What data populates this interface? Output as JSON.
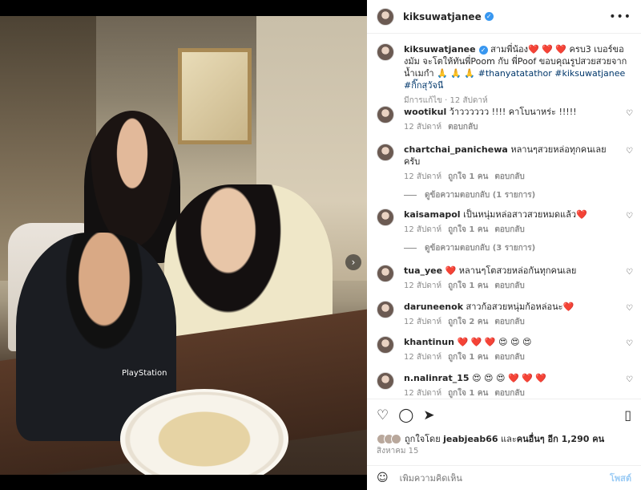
{
  "post": {
    "username": "kiksuwatjanee",
    "caption_text": "สามพี่น้อง❤️ ❤️ ❤️ ครบ3 เบอร์ของมัม จะโตให้ทันพี่Poom กับ พี่Poof ขอบคุณรูปสวยสวยจากน้ำเมกำ 🙏 🙏 🙏",
    "hashtags": [
      "#thanyatatathor",
      "#kiksuwatjanee",
      "#กิ๊กสุวัจนี"
    ],
    "caption_meta": "มีการแก้ไข · 12 สัปดาห์"
  },
  "comments": [
    {
      "user": "wootikul",
      "text": "ว้าวววววว !!!! คาโบนาหร่ะ !!!!!",
      "time": "12 สัปดาห์",
      "likes": "",
      "reply": "ตอบกลับ",
      "view_replies": ""
    },
    {
      "user": "chartchai_panichewa",
      "text": "หลานๆสวยหล่อทุกคนเลยครับ",
      "time": "12 สัปดาห์",
      "likes": "ถูกใจ 1 คน",
      "reply": "ตอบกลับ",
      "view_replies": "ดูข้อความตอบกลับ (1 รายการ)"
    },
    {
      "user": "kaisamapol",
      "text": "เป็นหนุ่มหล่อสาวสวยหมดแล้ว❤️",
      "time": "12 สัปดาห์",
      "likes": "ถูกใจ 1 คน",
      "reply": "ตอบกลับ",
      "view_replies": "ดูข้อความตอบกลับ (3 รายการ)"
    },
    {
      "user": "tua_yee",
      "text": "❤️ หลานๆโตสวยหล่อกันทุกคนเลย",
      "time": "12 สัปดาห์",
      "likes": "ถูกใจ 1 คน",
      "reply": "ตอบกลับ",
      "view_replies": ""
    },
    {
      "user": "daruneenok",
      "text": "สาวก้อสวยหนุ่มก้อหล่อนะ❤️",
      "time": "12 สัปดาห์",
      "likes": "ถูกใจ 2 คน",
      "reply": "ตอบกลับ",
      "view_replies": ""
    },
    {
      "user": "khantinun",
      "text": "❤️ ❤️ ❤️ 😍 😍 😍",
      "time": "12 สัปดาห์",
      "likes": "ถูกใจ 1 คน",
      "reply": "ตอบกลับ",
      "view_replies": ""
    },
    {
      "user": "n.nalinrat_15",
      "text": "😍 😍 😍 ❤️ ❤️ ❤️",
      "time": "12 สัปดาห์",
      "likes": "ถูกใจ 1 คน",
      "reply": "ตอบกลับ",
      "view_replies": ""
    }
  ],
  "likes_text": {
    "prefix": "ถูกใจโดย ",
    "user": "jeabjeab66",
    "mid": " และ",
    "rest": "คนอื่นๆ อีก 1,290 คน"
  },
  "date": "สิงหาคม 15",
  "add_comment_placeholder": "เพิ่มความคิดเห็น",
  "post_label": "โพสต์",
  "photo_brand": "PlayStation",
  "colors": {
    "accent": "#3897f0",
    "muted": "#8e8e8e",
    "text": "#262626"
  }
}
